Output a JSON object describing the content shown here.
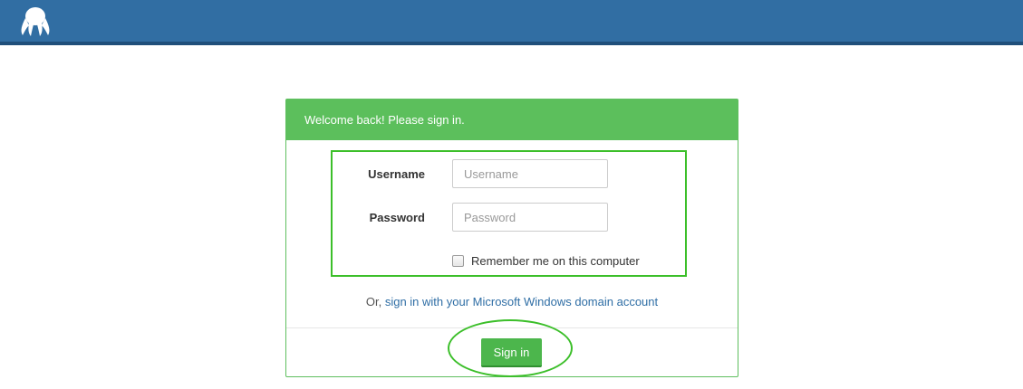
{
  "header": {
    "logo_icon": "octopus-logo-icon",
    "bar_color": "#316ea3"
  },
  "panel": {
    "title": "Welcome back! Please sign in.",
    "header_color": "#5cbf5c",
    "username": {
      "label": "Username",
      "placeholder": "Username",
      "value": ""
    },
    "password": {
      "label": "Password",
      "placeholder": "Password",
      "value": ""
    },
    "remember": {
      "label": "Remember me on this computer",
      "checked": false
    },
    "alt_signin": {
      "prefix": "Or,",
      "link_text": "sign in with your Microsoft Windows domain account"
    },
    "signin_button": {
      "label": "Sign in",
      "color": "#4cb64c"
    },
    "annotation_color": "#3cbf2a"
  }
}
